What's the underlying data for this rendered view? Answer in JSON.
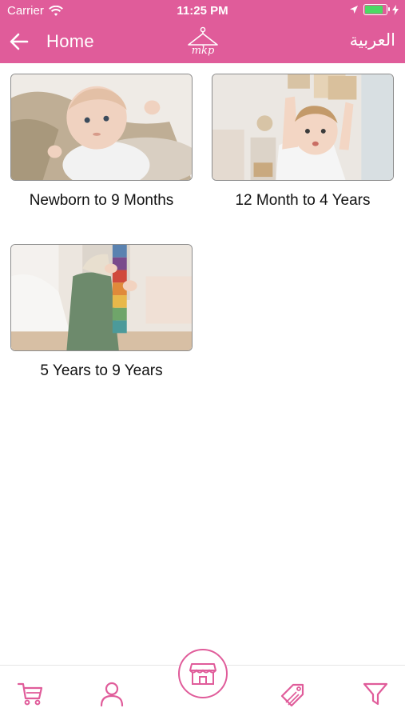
{
  "status_bar": {
    "carrier": "Carrier",
    "time": "11:25 PM"
  },
  "nav": {
    "title": "Home",
    "language": "العربية",
    "logo_text": "mkp"
  },
  "categories": [
    {
      "label": "Newborn to 9 Months"
    },
    {
      "label": "12 Month to 4 Years"
    },
    {
      "label": "5 Years to 9 Years"
    }
  ],
  "tab_bar": {
    "items": [
      "cart-icon",
      "profile-icon",
      "store-icon",
      "tags-icon",
      "filter-icon"
    ]
  },
  "colors": {
    "brand": "#e05c9a",
    "text": "#111111"
  }
}
